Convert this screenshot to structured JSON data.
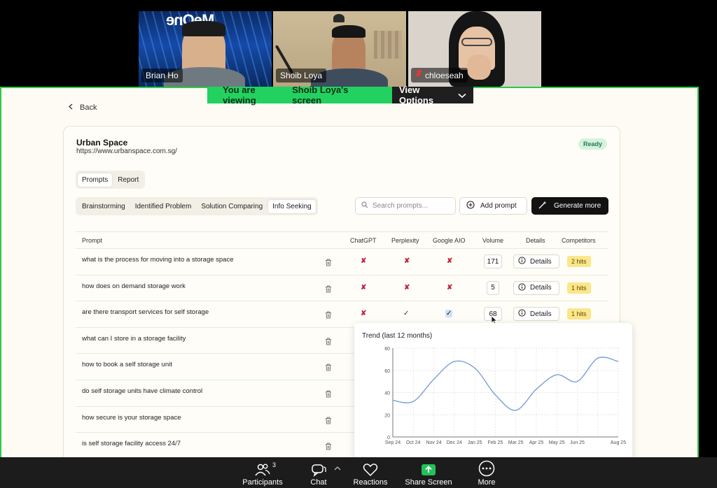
{
  "participants_video": [
    {
      "name": "Brian Ho",
      "logo": "MeOne"
    },
    {
      "name": "Shoib Loya"
    },
    {
      "name": "chloeseah",
      "muted": true
    }
  ],
  "banner": {
    "prefix": "You are viewing",
    "presenter": "Shoib Loya's screen",
    "options": "View Options"
  },
  "page": {
    "back": "Back",
    "site_name": "Urban Space",
    "site_url": "https://www.urbanspace.com.sg/",
    "status": "Ready",
    "tabs": [
      "Prompts",
      "Report"
    ],
    "categories": [
      "Brainstorming",
      "Identified Problem",
      "Solution Comparing",
      "Info Seeking"
    ],
    "search_placeholder": "Search prompts...",
    "add_prompt": "Add prompt",
    "generate_more": "Generate more",
    "columns": {
      "prompt": "Prompt",
      "chatgpt": "ChatGPT",
      "perplexity": "Perplexity",
      "google_aio": "Google AIO",
      "volume": "Volume",
      "details": "Details",
      "competitors": "Competitors"
    },
    "rows": [
      {
        "prompt": "what is the process for moving into a storage space",
        "chatgpt": "✘",
        "perplexity": "✘",
        "google_aio": "✘",
        "volume": "171",
        "details": "Details",
        "competitors": "2 hits"
      },
      {
        "prompt": "how does on demand storage work",
        "chatgpt": "✘",
        "perplexity": "✘",
        "google_aio": "✘",
        "volume": "5",
        "details": "Details",
        "competitors": "1 hits"
      },
      {
        "prompt": "are there transport services for self storage",
        "chatgpt": "✘",
        "perplexity": "✓",
        "google_aio": "✓",
        "volume": "68",
        "details": "Details",
        "competitors": "1 hits"
      },
      {
        "prompt": "what can I store in a storage facility"
      },
      {
        "prompt": "how to book a self storage unit"
      },
      {
        "prompt": "do self storage units have climate control"
      },
      {
        "prompt": "how secure is your storage space"
      },
      {
        "prompt": "is self storage facility access 24/7"
      }
    ]
  },
  "trend": {
    "title": "Trend (last 12 months)"
  },
  "chart_data": {
    "type": "line",
    "title": "Trend (last 12 months)",
    "x": [
      "Sep 24",
      "Oct 24",
      "Nov 24",
      "Dec 24",
      "Jan 25",
      "Feb 25",
      "Mar 25",
      "Apr 25",
      "May 25",
      "Jun 25",
      "Aug 25"
    ],
    "x_ticks": [
      "Sep 24",
      "Oct 24",
      "Nov 24",
      "Dec 24",
      "Jan 25",
      "Feb 25",
      "Mar 25",
      "Apr 25",
      "May 25",
      "Jun 25",
      "Aug 25"
    ],
    "points": [
      {
        "x": "Sep 24",
        "y": 33
      },
      {
        "x": "Oct 24",
        "y": 32
      },
      {
        "x": "Nov 24",
        "y": 52
      },
      {
        "x": "Dec 24",
        "y": 68
      },
      {
        "x": "Jan 25",
        "y": 62
      },
      {
        "x": "Feb 25",
        "y": 38
      },
      {
        "x": "Mar 25",
        "y": 24
      },
      {
        "x": "Apr 25",
        "y": 43
      },
      {
        "x": "May 25",
        "y": 56
      },
      {
        "x": "Jun 25",
        "y": 50
      },
      {
        "x": "Jul 25",
        "y": 71
      },
      {
        "x": "Aug 25",
        "y": 68
      }
    ],
    "ylim": [
      0,
      80
    ],
    "y_ticks": [
      0,
      20,
      40,
      60,
      80
    ],
    "grid": true,
    "color": "#7a9fd6"
  },
  "toolbar": {
    "participants": "Participants",
    "participants_count": "3",
    "chat": "Chat",
    "reactions": "Reactions",
    "share_screen": "Share Screen",
    "more": "More"
  },
  "colors": {
    "banner_green": "#23d160",
    "screen_border": "#2ec84a",
    "ready_badge": "#d4f2df",
    "hits_badge": "#fbe68a",
    "fail_mark": "#c0243f",
    "share_screen": "#23c15a"
  }
}
